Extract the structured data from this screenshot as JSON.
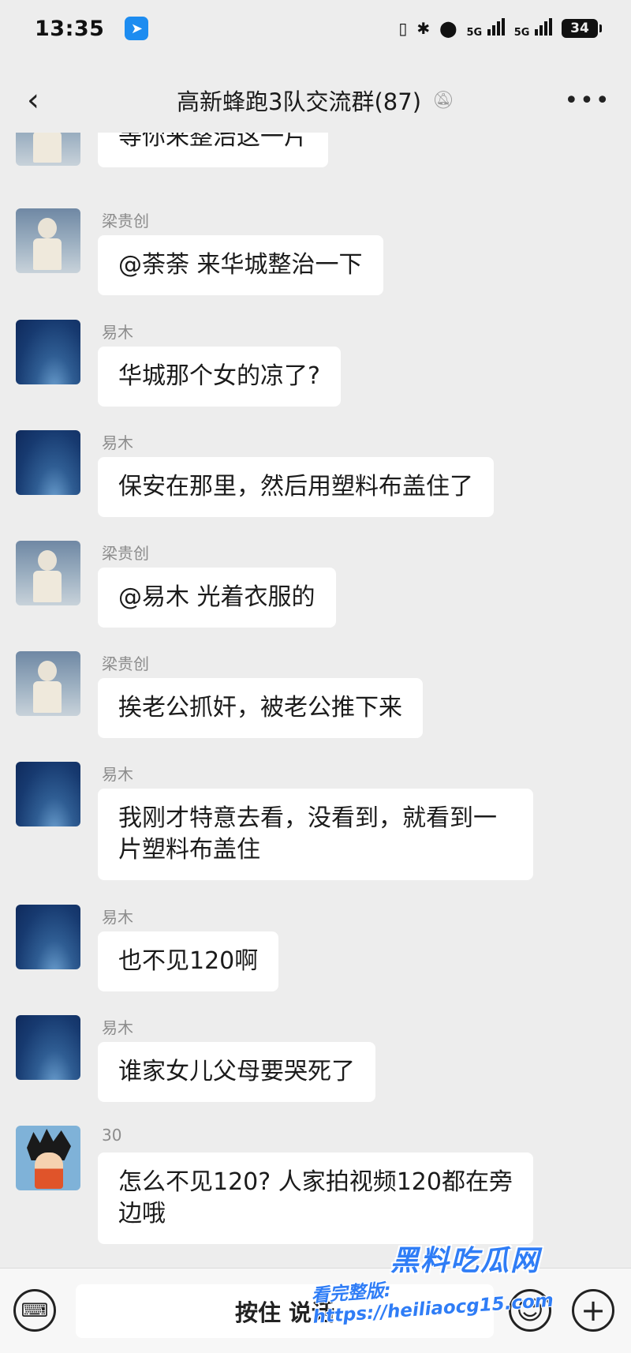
{
  "status_bar": {
    "time": "13:35",
    "app_badge_icon": "paper-plane-icon",
    "network_1": "5G",
    "network_2": "5G",
    "battery": "34"
  },
  "nav": {
    "title": "高新蜂跑3队交流群(87)",
    "back_icon": "chevron-left-icon",
    "mute_icon": "bell-off-icon",
    "more_icon": "more-dots-icon"
  },
  "messages": [
    {
      "sender": "",
      "avatar": "kid",
      "text": "等你来整治这一片"
    },
    {
      "sender": "梁贵创",
      "avatar": "kid",
      "text": "@荼荼  来华城整治一下"
    },
    {
      "sender": "易木",
      "avatar": "night",
      "text": "华城那个女的凉了?"
    },
    {
      "sender": "易木",
      "avatar": "night",
      "text": "保安在那里，然后用塑料布盖住了"
    },
    {
      "sender": "梁贵创",
      "avatar": "kid",
      "text": "@易木  光着衣服的"
    },
    {
      "sender": "梁贵创",
      "avatar": "kid",
      "text": "挨老公抓奸，被老公推下来"
    },
    {
      "sender": "易木",
      "avatar": "night",
      "text": "我刚才特意去看，没看到，就看到一片塑料布盖住"
    },
    {
      "sender": "易木",
      "avatar": "night",
      "text": "也不见120啊"
    },
    {
      "sender": "易木",
      "avatar": "night",
      "text": "谁家女儿父母要哭死了"
    },
    {
      "sender": "30",
      "avatar": "goku",
      "text": "怎么不见120? 人家拍视频120都在旁边哦"
    }
  ],
  "input_bar": {
    "hold_to_talk": "按住 说话",
    "keyboard_icon": "keyboard-icon",
    "emoji_icon": "smiley-icon",
    "plus_icon": "plus-icon"
  },
  "watermark": {
    "brand": "黑料吃瓜网",
    "url": "看完整版: https://heiliaocg15.com"
  },
  "colors": {
    "background": "#ededed",
    "bubble": "#ffffff",
    "sender_name": "#8c8c8c",
    "watermark": "#2f7df6"
  }
}
